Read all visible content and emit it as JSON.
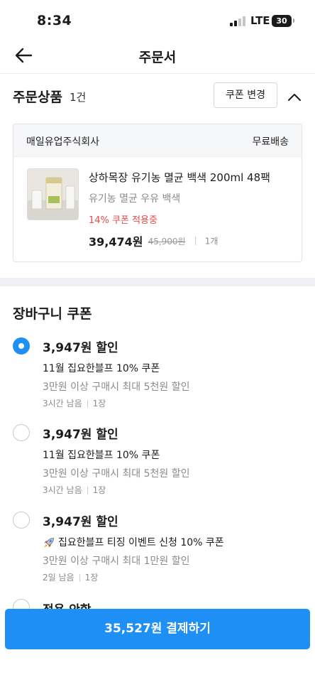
{
  "status_bar": {
    "time": "8:34",
    "network": "LTE",
    "battery": "30"
  },
  "header": {
    "title": "주문서",
    "back_icon": "arrow-left-icon"
  },
  "order": {
    "title": "주문상품",
    "count": "1건",
    "coupon_change_label": "쿠폰 변경",
    "collapse_icon": "chevron-up-icon",
    "seller": "매일유업주식회사",
    "shipping": "무료배송",
    "product": {
      "name": "상하목장 유기농 멸균 백색 200ml 48팩",
      "option": "유기농 멸균 우유 백색",
      "coupon_applied": "14% 쿠폰 적용중",
      "price": "39,474원",
      "original_price": "45,900원",
      "quantity": "1개"
    }
  },
  "cart_coupons": {
    "title": "장바구니 쿠폰",
    "items": [
      {
        "amount": "3,947원 할인",
        "name": "11월 집요한블프 10% 쿠폰",
        "condition": "3만원 이상 구매시 최대 5천원 할인",
        "time_left": "3시간 남음",
        "count": "1장",
        "selected": true
      },
      {
        "amount": "3,947원 할인",
        "name": "11월 집요한블프 10% 쿠폰",
        "condition": "3만원 이상 구매시 최대 5천원 할인",
        "time_left": "3시간 남음",
        "count": "1장",
        "selected": false
      },
      {
        "amount": "3,947원 할인",
        "name": "집요한블프 티징 이벤트 신청 10% 쿠폰",
        "condition": "3만원 이상 구매시 최대 1만원 할인",
        "time_left": "2일 남음",
        "count": "1장",
        "selected": false,
        "icon": "rocket-icon"
      }
    ],
    "partial_next": "적용 안함"
  },
  "pay_button": {
    "label": "35,527원 결제하기"
  },
  "colors": {
    "accent": "#1e8ff5",
    "coupon_red": "#e94a4a",
    "muted": "#8b8b8b"
  }
}
